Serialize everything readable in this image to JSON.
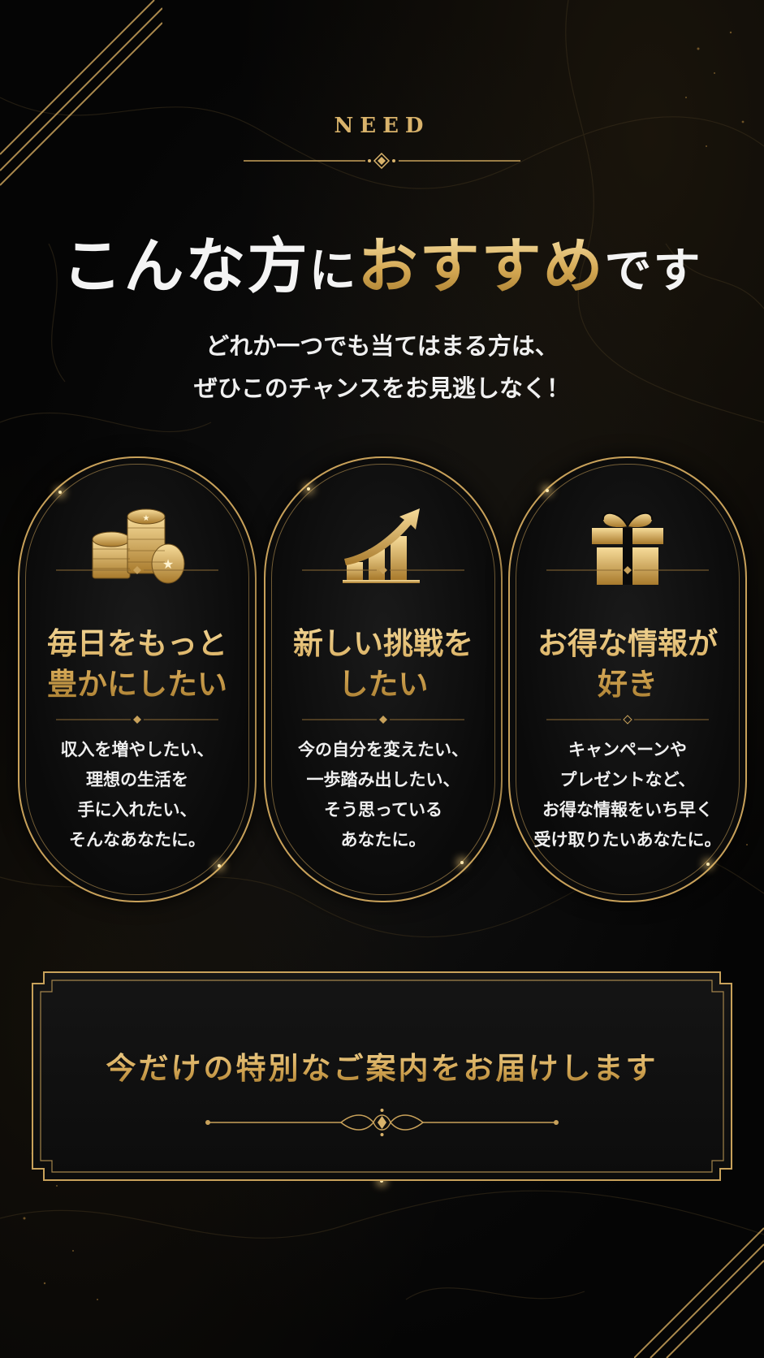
{
  "section": {
    "eyebrow": "NEED",
    "headline": {
      "part1": "こんな方",
      "part2": "に",
      "part3": "おすすめ",
      "part4": "です"
    },
    "lead_line1": "どれか一つでも当てはまる方は、",
    "lead_line2": "ぜひこのチャンスをお見逃しなく！"
  },
  "cards": [
    {
      "icon": "coins-icon",
      "title": "毎日をもっと\n豊かにしたい",
      "description": "収入を増やしたい、\n理想の生活を\n手に入れたい、\nそんなあなたに。"
    },
    {
      "icon": "growth-chart-icon",
      "title": "新しい挑戦を\nしたい",
      "description": "今の自分を変えたい、\n一歩踏み出したい、\nそう思っている\nあなたに。"
    },
    {
      "icon": "gift-icon",
      "title": "お得な情報が\n好き",
      "description": "キャンペーンや\nプレゼントなど、\nお得な情報をいち早く\n受け取りたいあなたに。"
    }
  ],
  "cta": {
    "text": "今だけの特別なご案内をお届けします"
  },
  "colors": {
    "gold": "#d3a654",
    "gold_light": "#f3d797",
    "background": "#050505",
    "text": "#f0f0f0"
  }
}
